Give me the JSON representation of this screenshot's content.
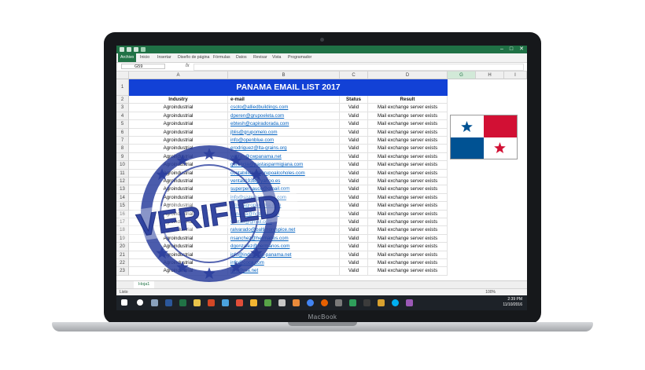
{
  "device": {
    "brand": "MacBook"
  },
  "excel": {
    "file_tab": "Archivo",
    "ribbon_tabs": [
      "Inicio",
      "Insertar",
      "Diseño de página",
      "Fórmulas",
      "Datos",
      "Revisar",
      "Vista",
      "Programador"
    ],
    "name_box": "G59",
    "fx": "fx",
    "columns": [
      "A",
      "B",
      "C",
      "D",
      "G",
      "H",
      "I"
    ],
    "selected_column": "G",
    "sheet_title": "PANAMA EMAIL LIST 2017",
    "headers": {
      "industry": "Industry",
      "email": "e-mail",
      "status": "Status",
      "result": "Result"
    },
    "rows": [
      {
        "n": "3",
        "industry": "Agroindustrial",
        "email": "csoto@alliedbuildings.com",
        "status": "Valid",
        "result": "Mail exchange server exists"
      },
      {
        "n": "4",
        "industry": "Agroindustrial",
        "email": "dperen@grupoeleta.com",
        "status": "Valid",
        "result": "Mail exchange server exists"
      },
      {
        "n": "5",
        "industry": "Agroindustrial",
        "email": "ebtesh@capiradorada.com",
        "status": "Valid",
        "result": "Mail exchange server exists"
      },
      {
        "n": "6",
        "industry": "Agroindustrial",
        "email": "jblis@grupomelo.com",
        "status": "Valid",
        "result": "Mail exchange server exists"
      },
      {
        "n": "7",
        "industry": "Agroindustrial",
        "email": "info@openblue.com",
        "status": "Valid",
        "result": "Mail exchange server exists"
      },
      {
        "n": "8",
        "industry": "Agroindustrial",
        "email": "erodriguez@lta-grains.org",
        "status": "Valid",
        "result": "Mail exchange server exists"
      },
      {
        "n": "9",
        "industry": "Agroindustrial",
        "email": "ventas@cwpanama.net",
        "status": "Valid",
        "result": "Mail exchange server exists"
      },
      {
        "n": "10",
        "industry": "Agroindustrial",
        "email": "gerencia@pastasparmigiana.com",
        "status": "Valid",
        "result": "Mail exchange server exists"
      },
      {
        "n": "11",
        "industry": "Agroindustrial",
        "email": "contabilidad@grupoalcoholes.com",
        "status": "Valid",
        "result": "Mail exchange server exists"
      },
      {
        "n": "12",
        "industry": "Agroindustrial",
        "email": "ventas1938@yahoo.es",
        "status": "Valid",
        "result": "Mail exchange server exists"
      },
      {
        "n": "13",
        "industry": "Agroindustrial",
        "email": "superpersauce@gmail.com",
        "status": "Valid",
        "result": "Mail exchange server exists"
      },
      {
        "n": "14",
        "industry": "Agroindustrial",
        "email": "info@sistemascaribe.com",
        "status": "Valid",
        "result": "Mail exchange server exists"
      },
      {
        "n": "15",
        "industry": "Agroindustrial",
        "email": "info@agropanama.com",
        "status": "Valid",
        "result": "Mail exchange server exists"
      },
      {
        "n": "16",
        "industry": "Agroindustrial",
        "email": "panama@hotmail.com",
        "status": "Valid",
        "result": "Mail exchange server exists"
      },
      {
        "n": "17",
        "industry": "Agroindustrial",
        "email": "ventas@gmail.com",
        "status": "Valid",
        "result": "Mail exchange server exists"
      },
      {
        "n": "18",
        "industry": "Agroindustrial",
        "email": "ralvarado@baltimorespice.net",
        "status": "Valid",
        "result": "Mail exchange server exists"
      },
      {
        "n": "19",
        "industry": "Agroindustrial",
        "email": "nsanchez@hermanos.com",
        "status": "Valid",
        "result": "Mail exchange server exists"
      },
      {
        "n": "20",
        "industry": "Agroindustrial",
        "email": "dgonzalez@hermanos.com",
        "status": "Valid",
        "result": "Mail exchange server exists"
      },
      {
        "n": "21",
        "industry": "Agroindustrial",
        "email": "info@industrias-panama.net",
        "status": "Valid",
        "result": "Mail exchange server exists"
      },
      {
        "n": "22",
        "industry": "Agroindustrial",
        "email": "info@coca.com",
        "status": "Valid",
        "result": "Mail exchange server exists"
      },
      {
        "n": "23",
        "industry": "Agroindustrial",
        "email": "info@rsa.net",
        "status": "Valid",
        "result": "Mail exchange server exists"
      }
    ],
    "sheet_tab": "Hoja1",
    "status_left": "Listo",
    "zoom": "100%"
  },
  "stamp": {
    "text": "VERIFIED"
  },
  "taskbar": {
    "time": "2:39 PM",
    "date": "11/10/2016"
  }
}
